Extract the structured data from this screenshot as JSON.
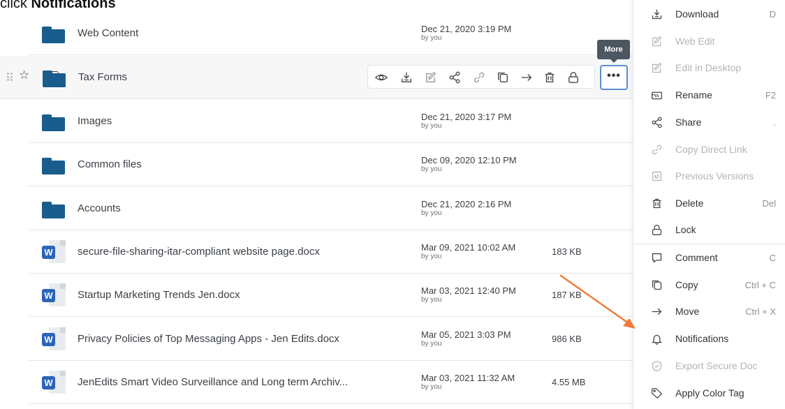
{
  "instruction": {
    "prefix": "click ",
    "emphasis": "Notifications"
  },
  "files": [
    {
      "name": "Web Content",
      "type": "folder",
      "date": "Dec 21, 2020 3:19 PM",
      "by": "by you",
      "size": ""
    },
    {
      "name": "Tax Forms",
      "type": "folder",
      "date": "",
      "by": "",
      "size": ""
    },
    {
      "name": "Images",
      "type": "folder",
      "date": "Dec 21, 2020 3:17 PM",
      "by": "by you",
      "size": ""
    },
    {
      "name": "Common files",
      "type": "folder",
      "date": "Dec 09, 2020 12:10 PM",
      "by": "by you",
      "size": ""
    },
    {
      "name": "Accounts",
      "type": "folder",
      "date": "Dec 21, 2020 2:16 PM",
      "by": "by you",
      "size": ""
    },
    {
      "name": "secure-file-sharing-itar-compliant website page.docx",
      "type": "word",
      "date": "Mar 09, 2021 10:02 AM",
      "by": "by you",
      "size": "183 KB"
    },
    {
      "name": "Startup Marketing Trends Jen.docx",
      "type": "word",
      "date": "Mar 03, 2021 12:40 PM",
      "by": "by you",
      "size": "187 KB"
    },
    {
      "name": "Privacy Policies of Top Messaging Apps - Jen Edits.docx",
      "type": "word",
      "date": "Mar 05, 2021 3:03 PM",
      "by": "by you",
      "size": "986 KB"
    },
    {
      "name": "JenEdits Smart Video Surveillance and Long term Archiv...",
      "type": "word",
      "date": "Mar 03, 2021 11:32 AM",
      "by": "by you",
      "size": "4.55 MB"
    }
  ],
  "word_badge": "W",
  "more_button": {
    "label": "•••",
    "tooltip": "More"
  },
  "hover_toolbar_icons": [
    "eye-icon",
    "download-icon",
    "edit-icon",
    "share-icon",
    "link-icon",
    "copy-icon",
    "move-icon",
    "delete-icon",
    "lock-icon"
  ],
  "menu": [
    {
      "label": "Download",
      "shortcut": "D",
      "icon": "download-icon",
      "disabled": false
    },
    {
      "label": "Web Edit",
      "shortcut": "",
      "icon": "edit-icon",
      "disabled": true
    },
    {
      "label": "Edit in Desktop",
      "shortcut": "",
      "icon": "edit-icon",
      "disabled": true
    },
    {
      "label": "Rename",
      "shortcut": "F2",
      "icon": "rename-icon",
      "disabled": false
    },
    {
      "label": "Share",
      "shortcut": ".",
      "icon": "share-icon",
      "disabled": false
    },
    {
      "label": "Copy Direct Link",
      "shortcut": "",
      "icon": "link-icon",
      "disabled": true
    },
    {
      "label": "Previous Versions",
      "shortcut": "",
      "icon": "versions-icon",
      "disabled": true
    },
    {
      "label": "Delete",
      "shortcut": "Del",
      "icon": "delete-icon",
      "disabled": false
    },
    {
      "label": "Lock",
      "shortcut": "",
      "icon": "lock-icon",
      "disabled": false
    },
    {
      "label": "Comment",
      "shortcut": "C",
      "icon": "comment-icon",
      "disabled": false
    },
    {
      "label": "Copy",
      "shortcut": "Ctrl + C",
      "icon": "copy-icon",
      "disabled": false
    },
    {
      "label": "Move",
      "shortcut": "Ctrl + X",
      "icon": "move-icon",
      "disabled": false
    },
    {
      "label": "Notifications",
      "shortcut": "",
      "icon": "bell-icon",
      "disabled": false
    },
    {
      "label": "Export Secure Doc",
      "shortcut": "",
      "icon": "shield-icon",
      "disabled": true
    },
    {
      "label": "Apply Color Tag",
      "shortcut": "",
      "icon": "tag-icon",
      "disabled": false
    }
  ],
  "colors": {
    "folder": "#1a5c8c",
    "word_badge": "#2b64b8",
    "annotation_arrow": "#f07a3a",
    "focus_border": "#5b8ed0"
  }
}
